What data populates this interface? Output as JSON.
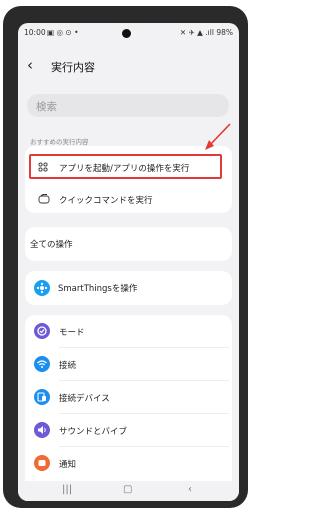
{
  "status": {
    "time": "10:00",
    "indicators": "▣ ◎ ⊙ •",
    "battery": "98%",
    "icons_right": "✕ ✈ ▲ .ıll"
  },
  "header": {
    "title": "実行内容"
  },
  "search": {
    "placeholder": "検索"
  },
  "recommended": {
    "section_label": "おすすめの実行内容",
    "items": [
      {
        "label": "アプリを起動/アプリの操作を実行",
        "icon": "apps-grid-icon"
      },
      {
        "label": "クイックコマンドを実行",
        "icon": "quick-command-icon"
      }
    ]
  },
  "all_operations": {
    "label": "全ての操作"
  },
  "smartthings": {
    "label": "SmartThingsを操作",
    "color": "#1a9ff0"
  },
  "list": [
    {
      "label": "モード",
      "icon": "mode-icon",
      "color": "#6c5ad6"
    },
    {
      "label": "接続",
      "icon": "wifi-icon",
      "color": "#1a8ff0"
    },
    {
      "label": "接続デバイス",
      "icon": "devices-icon",
      "color": "#1a8ff0"
    },
    {
      "label": "サウンドとバイブ",
      "icon": "sound-icon",
      "color": "#6c5ad6"
    },
    {
      "label": "通知",
      "icon": "notification-icon",
      "color": "#ef6a34"
    }
  ],
  "colors": {
    "highlight": "#e03a3a",
    "background": "#f2f2f4"
  }
}
